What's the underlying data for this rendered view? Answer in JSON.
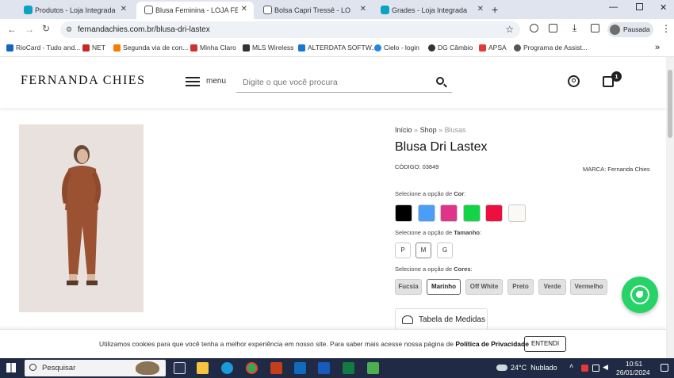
{
  "browser": {
    "tabs": [
      {
        "title": "Produtos - Loja Integrada",
        "color": "#0aa3c2"
      },
      {
        "title": "Blusa Feminina - LOJA FERNANDA CHIES",
        "color": "#333333"
      },
      {
        "title": "Bolsa Capri Tressê - LOJA FERNANDA",
        "color": "#333333"
      },
      {
        "title": "Grades - Loja Integrada",
        "color": "#0aa3c2"
      }
    ],
    "url": "fernandachies.com.br/blusa-dri-lastex",
    "profile_label": "Pausada",
    "bookmarks": [
      {
        "label": "RioCard - Tudo and...",
        "color": "#1565c0"
      },
      {
        "label": "NET",
        "color": "#c62828"
      },
      {
        "label": "Segunda via de con...",
        "color": "#f57c00"
      },
      {
        "label": "Minha Claro",
        "color": "#d32f2f"
      },
      {
        "label": "MLS Wireless",
        "color": "#333333"
      },
      {
        "label": "ALTERDATA SOFTW...",
        "color": "#1976d2"
      },
      {
        "label": "Cielo - login",
        "color": "#1e88e5"
      },
      {
        "label": "DG Câmbio",
        "color": "#333333"
      },
      {
        "label": "APSA",
        "color": "#e53935"
      },
      {
        "label": "Programa de Assist...",
        "color": "#555555"
      }
    ]
  },
  "header": {
    "logo": "FERNANDA CHIES",
    "menu_label": "menu",
    "search_placeholder": "Digite o que você procura",
    "cart_count": "1"
  },
  "breadcrumb": {
    "home": "Início",
    "sep": "»",
    "shop": "Shop",
    "current": "Blusas"
  },
  "product": {
    "title": "Blusa Dri Lastex",
    "code": "CÓDIGO: 03849",
    "brand": "MARCA: Fernanda Chies",
    "color_label_prefix": "Selecione a opção de ",
    "color_label": "Cor",
    "colors": [
      "#000000",
      "#4b9ef5",
      "#e0338a",
      "#13d447",
      "#ef0f3f",
      "#fbf9f6"
    ],
    "size_label_prefix": "Selecione a opção de ",
    "size_label": "Tamanho",
    "sizes": [
      "P",
      "M",
      "G"
    ],
    "options_label_prefix": "Selecione a opção de ",
    "options_label": "Cores",
    "options": [
      "Fucsia",
      "Marinho",
      "Off White",
      "Preto",
      "Verde",
      "Vermelho"
    ],
    "size_table": "Tabela de Medidas"
  },
  "cookie": {
    "text": "Utilizamos cookies para que você tenha a melhor experiência em nosso site. Para saber mais acesse nossa página de ",
    "link": "Política de Privacidade",
    "button": "ENTENDI"
  },
  "taskbar": {
    "search": "Pesquisar",
    "weather": "24°C  Nublado",
    "time": "10:51",
    "date": "26/01/2024"
  }
}
